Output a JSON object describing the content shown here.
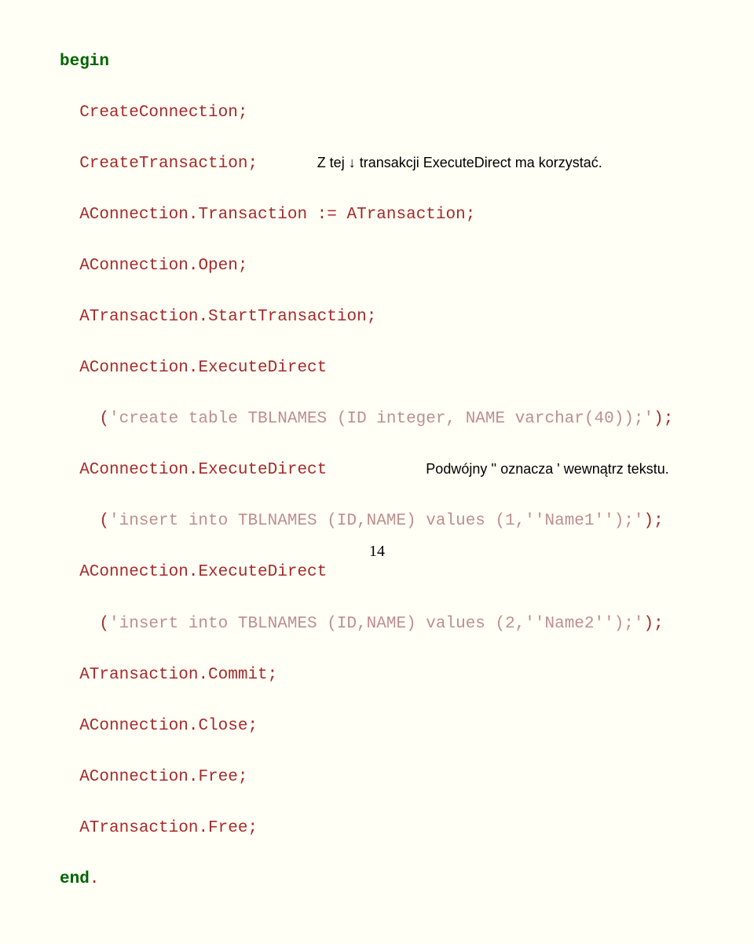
{
  "code": {
    "l1": "begin",
    "l2a": "  CreateConnection",
    "l2b": ";",
    "l3a": "  CreateTransaction",
    "l3b": ";",
    "l3comment": "Z tej ↓ transakcji ExecuteDirect ma korzystać.",
    "l4a": "  AConnection",
    "l4b": ".",
    "l4c": "Transaction",
    "l4d": " := ",
    "l4e": "ATransaction",
    "l4f": ";",
    "l5a": "  AConnection",
    "l5b": ".",
    "l5c": "Open",
    "l5d": ";",
    "l6a": "  ATransaction",
    "l6b": ".",
    "l6c": "StartTransaction",
    "l6d": ";",
    "l7a": "  AConnection",
    "l7b": ".",
    "l7c": "ExecuteDirect",
    "l8a": "    (",
    "l8b": "'create table TBLNAMES (ID integer, NAME varchar(40));'",
    "l8c": ");",
    "l9a": "  AConnection",
    "l9b": ".",
    "l9c": "ExecuteDirect",
    "l9comment": "Podwójny '' oznacza ' wewnątrz tekstu.",
    "l10a": "    (",
    "l10b": "'insert into TBLNAMES (ID,NAME) values (1,''Name1'');'",
    "l10c": ");",
    "l11a": "  AConnection",
    "l11b": ".",
    "l11c": "ExecuteDirect",
    "l12a": "    (",
    "l12b": "'insert into TBLNAMES (ID,NAME) values (2,''Name2'');'",
    "l12c": ");",
    "l13a": "  ATransaction",
    "l13b": ".",
    "l13c": "Commit",
    "l13d": ";",
    "l14a": "  AConnection",
    "l14b": ".",
    "l14c": "Close",
    "l14d": ";",
    "l15a": "  AConnection",
    "l15b": ".",
    "l15c": "Free",
    "l15d": ";",
    "l16a": "  ATransaction",
    "l16b": ".",
    "l16c": "Free",
    "l16d": ";",
    "l17": "end",
    "l17b": "."
  },
  "pagenum": "14"
}
